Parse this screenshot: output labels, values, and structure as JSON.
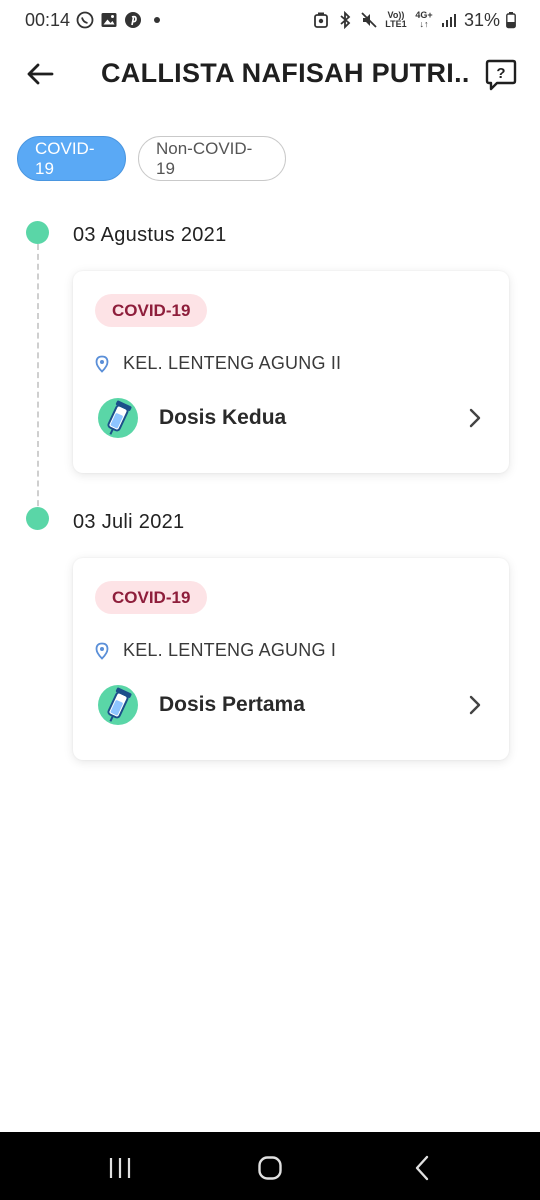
{
  "status_bar": {
    "time": "00:14",
    "left_icons": [
      "whatsapp-icon",
      "gallery-icon",
      "pinterest-icon",
      "dot-icon"
    ],
    "right_icons": [
      "saver-icon",
      "bluetooth-icon",
      "mute-icon",
      "volte-icon",
      "4g-icon",
      "signal-icon",
      "battery-icon"
    ],
    "volte_line1": "Vo))",
    "volte_line2": "LTE1",
    "network_line1": "4G+",
    "network_line2": "↓↑",
    "battery": "31%"
  },
  "header": {
    "title": "CALLISTA NAFISAH PUTRI...",
    "back_icon": "arrow-left-icon",
    "help_icon": "help-bubble-icon",
    "help_glyph": "?"
  },
  "filters": [
    {
      "label": "COVID-19",
      "active": true
    },
    {
      "label": "Non-COVID-19",
      "active": false
    }
  ],
  "records": [
    {
      "date": "03 Agustus 2021",
      "badge": "COVID-19",
      "location": "KEL. LENTENG AGUNG II",
      "dose": "Dosis Kedua"
    },
    {
      "date": "03 Juli 2021",
      "badge": "COVID-19",
      "location": "KEL. LENTENG AGUNG I",
      "dose": "Dosis Pertama"
    }
  ],
  "colors": {
    "accent": "#5aa9f5",
    "timeline_dot": "#5ad6a7",
    "badge_bg": "#fde3e6",
    "badge_text": "#8e1e3b"
  },
  "nav_bar": [
    "recents-icon",
    "home-icon",
    "back-icon"
  ]
}
